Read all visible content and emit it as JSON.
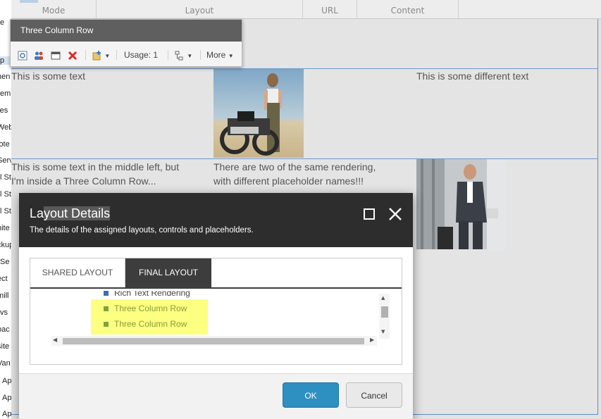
{
  "ribbon": {
    "columns": [
      "Mode",
      "Layout",
      "URL",
      "Content"
    ]
  },
  "left_tree": {
    "fragments": [
      "e",
      "p",
      "nen",
      "em",
      "res",
      "Web",
      "lote",
      "Serv",
      "l St",
      "l St",
      "l St",
      "nite",
      "ckup",
      "Se",
      "ect",
      "mill",
      "vs",
      "pac",
      "site",
      "Van",
      "Ap",
      "Ap",
      "App_Start"
    ]
  },
  "chrome": {
    "title": "Three Column Row",
    "usage_label": "Usage: 1",
    "more_label": "More"
  },
  "content": {
    "text_top_left": "This is some text",
    "text_top_right": "This is some different text",
    "text_mid_left_1": "This is some text in the middle left, but",
    "text_mid_left_2": "I'm inside a Three Column Row...",
    "text_mid_center_1": "There are two of the same rendering,",
    "text_mid_center_2": "with different placeholder names!!!"
  },
  "dialog": {
    "title": "Layout Details",
    "subtitle": "The details of the assigned layouts, controls and placeholders.",
    "tabs": [
      "SHARED LAYOUT",
      "FINAL LAYOUT"
    ],
    "active_tab": "FINAL LAYOUT",
    "tree_items": [
      {
        "label": "Rich Text Rendering",
        "color": "#444444",
        "bullet": "#3b6fb6"
      },
      {
        "label": "Three Column Row",
        "color": "#8a9b3a",
        "bullet": "#7da340"
      },
      {
        "label": "Three Column Row",
        "color": "#8a9b3a",
        "bullet": "#7da340"
      }
    ],
    "ok_label": "OK",
    "cancel_label": "Cancel"
  },
  "colors": {
    "highlight": "#fcff80",
    "ok_button": "#2e8fc1",
    "dialog_header": "#2d2d2d",
    "chrome_header": "#5f5f5f"
  }
}
